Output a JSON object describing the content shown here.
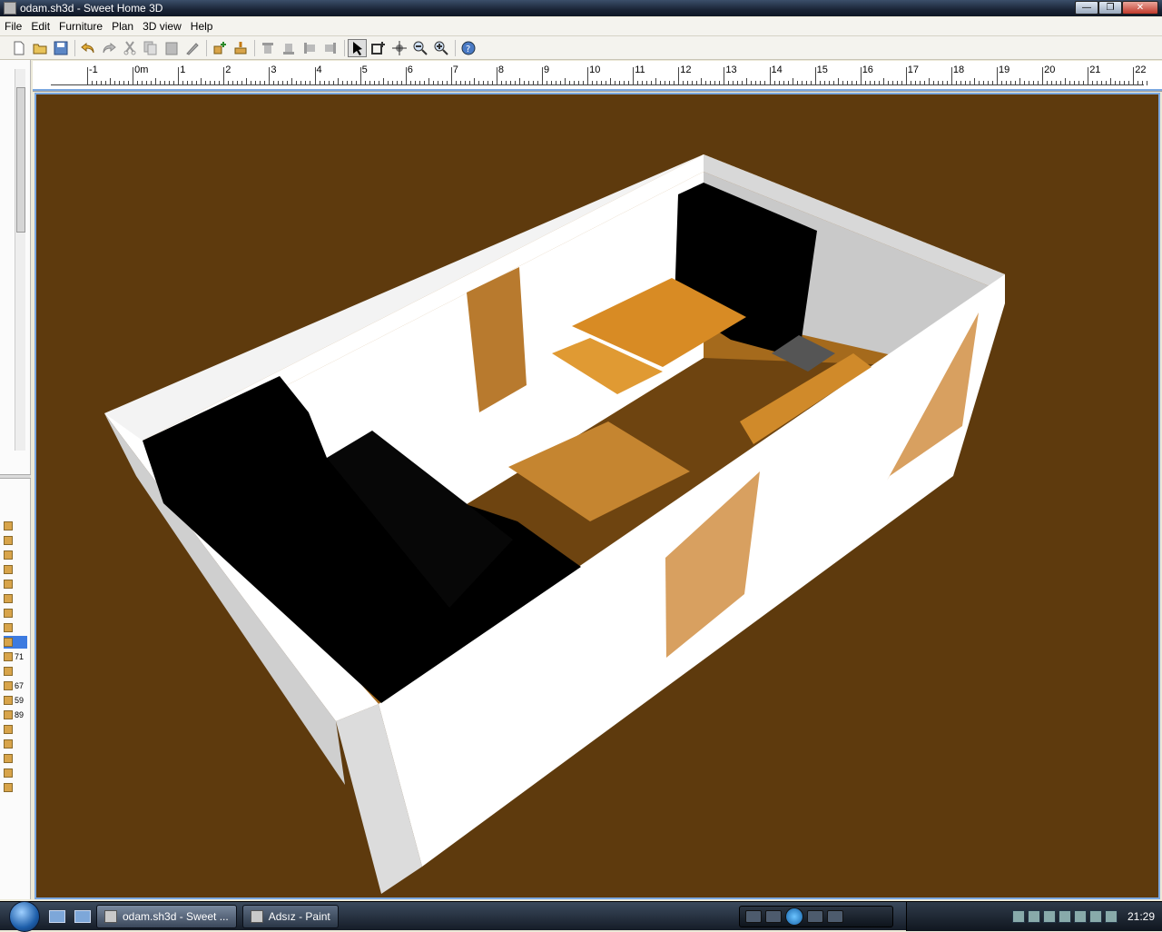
{
  "window": {
    "title": "odam.sh3d - Sweet Home 3D"
  },
  "menu": [
    "File",
    "Edit",
    "Furniture",
    "Plan",
    "3D view",
    "Help"
  ],
  "toolbar": {
    "buttons": [
      "new-icon",
      "open-icon",
      "save-icon",
      "undo-icon",
      "redo-icon",
      "cut-icon",
      "copy-icon",
      "paste-icon",
      "delete-icon",
      "add-furniture-icon",
      "import-furniture-icon",
      "align-top-icon",
      "align-bottom-icon",
      "align-left-icon",
      "align-right-icon",
      "select-mode-icon",
      "create-walls-icon",
      "pan-icon",
      "zoom-out-icon",
      "zoom-in-icon",
      "help-icon"
    ],
    "active": "select-mode-icon"
  },
  "ruler": {
    "labels": [
      "-1",
      "0m",
      "1",
      "2",
      "3",
      "4",
      "5",
      "6",
      "7",
      "8",
      "9",
      "10",
      "11",
      "12",
      "13",
      "14",
      "15",
      "16",
      "17",
      "18",
      "19",
      "20",
      "21",
      "22"
    ]
  },
  "furniture_list": {
    "values": [
      "71",
      "67",
      "59",
      "89"
    ]
  },
  "colors": {
    "floor": "#5e3a0d",
    "wall": "#ffffff",
    "accent": "#7aa7e0",
    "wood": "#d08a2a"
  },
  "taskbar": {
    "tasks": [
      "odam.sh3d - Sweet ...",
      "Adsız - Paint"
    ],
    "clock": "21:29"
  }
}
